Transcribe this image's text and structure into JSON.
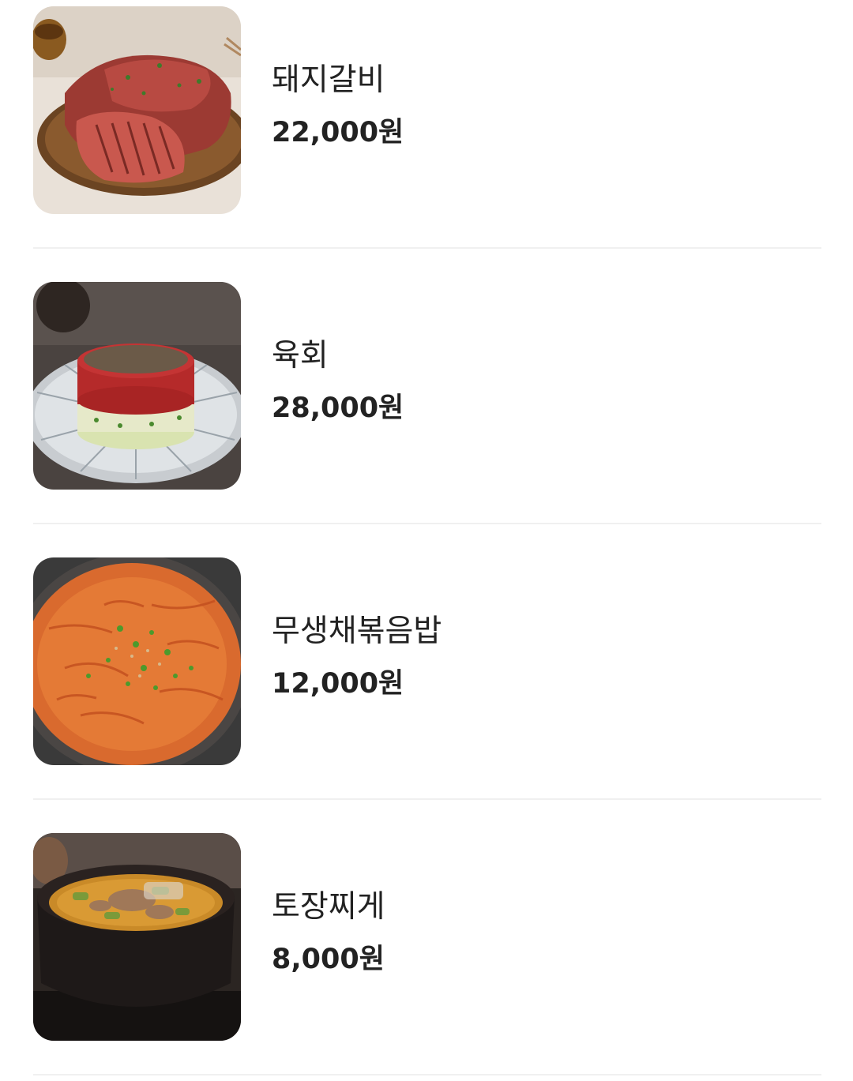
{
  "menu": {
    "items": [
      {
        "name": "돼지갈비",
        "price": "22,000원",
        "image": "pork-galbi-photo"
      },
      {
        "name": "육회",
        "price": "28,000원",
        "image": "yukhoe-photo"
      },
      {
        "name": "무생채볶음밥",
        "price": "12,000원",
        "image": "radish-fried-rice-photo"
      },
      {
        "name": "토장찌게",
        "price": "8,000원",
        "image": "doenjang-stew-photo"
      }
    ]
  },
  "colors": {
    "text": "#222222",
    "divider": "#f0f0f0",
    "background": "#ffffff"
  }
}
